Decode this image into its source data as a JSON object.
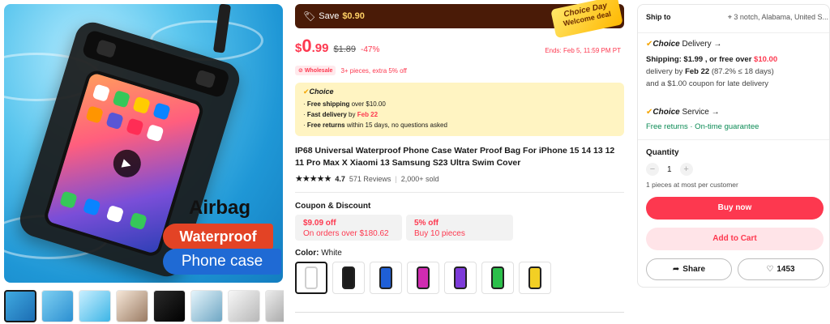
{
  "gallery": {
    "overlay": {
      "line1": "Airbag",
      "line2": "Waterproof",
      "line3": "Phone case"
    },
    "thumb_count": 8
  },
  "promo": {
    "save_label": "Save",
    "save_amount": "$0.90",
    "choice_day_line1": "Choice Day",
    "choice_day_line2": "Welcome deal"
  },
  "price": {
    "currency": "$",
    "whole": "0",
    "fraction": ".99",
    "original": "$1.89",
    "discount": "-47%",
    "ends": "Ends: Feb 5, 11:59 PM PT"
  },
  "wholesale": {
    "chip": "Wholesale",
    "text": "3+ pieces, extra 5% off"
  },
  "choice_box": {
    "logo": "Choice",
    "line1_bold": "Free shipping",
    "line1_rest": "over $10.00",
    "line2_bold": "Fast delivery",
    "line2_mid": "by",
    "line2_date": "Feb 22",
    "line3_bold": "Free returns",
    "line3_rest": "within 15 days, no questions asked"
  },
  "product": {
    "title": "IP68 Universal Waterproof Phone Case Water Proof Bag For iPhone 15 14 13 12 11 Pro Max X Xiaomi 13 Samsung S23 Ultra Swim Cover",
    "rating": "4.7",
    "reviews": "571 Reviews",
    "sold": "2,000+ sold"
  },
  "coupons": {
    "heading": "Coupon & Discount",
    "items": [
      {
        "value": "$9.09 off",
        "condition": "On orders over $180.62"
      },
      {
        "value": "5% off",
        "condition": "Buy 10 pieces"
      }
    ]
  },
  "color": {
    "label": "Color:",
    "selected": "White",
    "swatches": [
      "#ffffff",
      "#1b1b1b",
      "#1f5fd6",
      "#d02bb1",
      "#7d3bd9",
      "#2bbf4a",
      "#f2cf24"
    ]
  },
  "shipping": {
    "ship_to_label": "Ship to",
    "location": "3 notch, Alabama, United S...",
    "delivery_title": "Delivery",
    "shipping_line_label": "Shipping: $1.99 , or free over",
    "shipping_line_value": "$10.00",
    "delivery_by_label": "delivery by",
    "delivery_date": "Feb 22",
    "delivery_prob": "(87.2% ≤ 18 days)",
    "late_coupon": "and a $1.00 coupon for late delivery",
    "service_title": "Service",
    "service_detail": "Free returns · On-time guarantee",
    "choice_logo": "Choice"
  },
  "purchase": {
    "quantity_label": "Quantity",
    "quantity_value": "1",
    "quantity_note": "1 pieces at most per customer",
    "buy_now": "Buy now",
    "add_to_cart": "Add to Cart",
    "share": "Share",
    "wishlist_count": "1453"
  },
  "colors": {
    "accent": "#fd384f",
    "promo_bar": "#4a1b07",
    "choice_bg": "#fff4c2",
    "choice_gold": "#f5a500"
  }
}
